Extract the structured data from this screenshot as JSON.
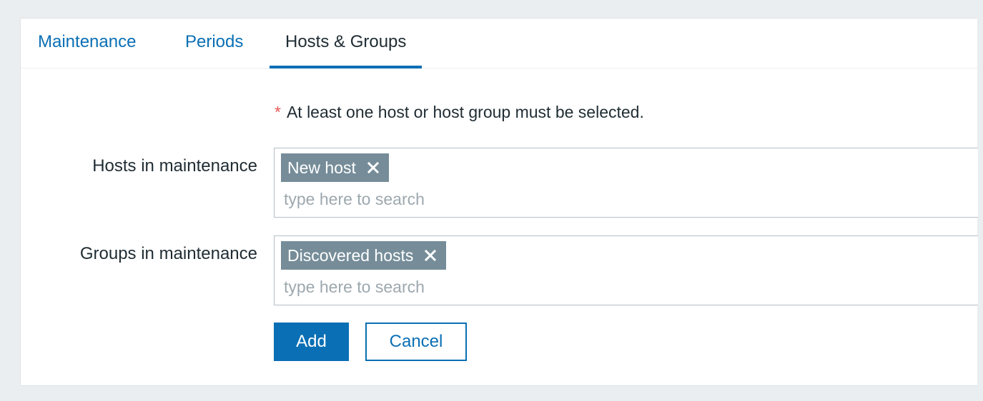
{
  "tabs": [
    {
      "label": "Maintenance",
      "active": false
    },
    {
      "label": "Periods",
      "active": false
    },
    {
      "label": "Hosts & Groups",
      "active": true
    }
  ],
  "form": {
    "required_asterisk": "*",
    "required_note": "At least one host or host group must be selected.",
    "hosts": {
      "label": "Hosts in maintenance",
      "selected": [
        "New host"
      ],
      "placeholder": "type here to search"
    },
    "groups": {
      "label": "Groups in maintenance",
      "selected": [
        "Discovered hosts"
      ],
      "placeholder": "type here to search"
    }
  },
  "buttons": {
    "add_label": "Add",
    "cancel_label": "Cancel"
  },
  "icons": {
    "chip_remove": "close-icon"
  },
  "colors": {
    "accent": "#0a6fb4",
    "chip_bg": "#768d99",
    "required": "#e45959",
    "page_bg": "#ebeef0"
  }
}
